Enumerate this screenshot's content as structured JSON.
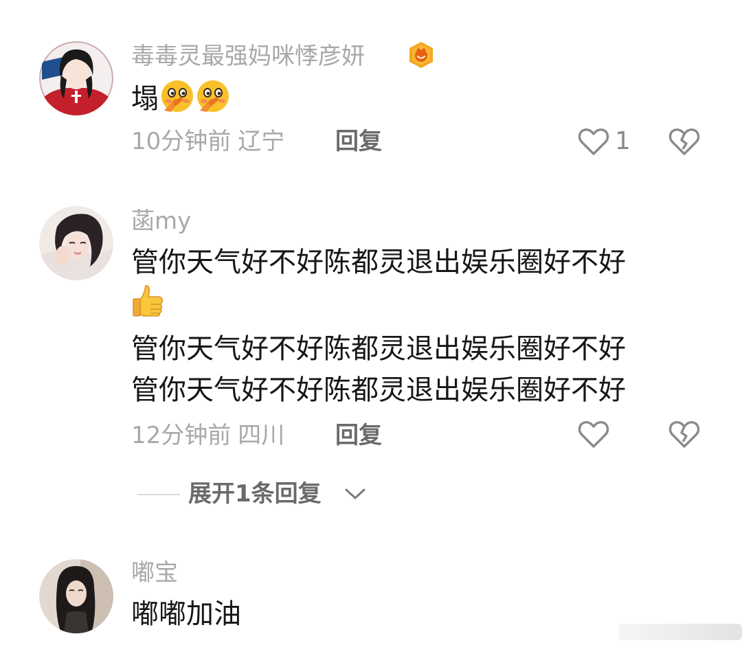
{
  "comments": [
    {
      "username": "毒毒灵最强妈咪悸彦妍",
      "has_badge": true,
      "text_lines": [
        "塌"
      ],
      "emoji": [
        "flushed-hand-over-mouth",
        "flushed-hand-over-mouth"
      ],
      "time": "10分钟前",
      "location": "辽宁",
      "reply_label": "回复",
      "like_count": "1"
    },
    {
      "username": "菡my",
      "text_lines": [
        "管你天气好不好陈都灵退出娱乐圈好不好",
        "管你天气好不好陈都灵退出娱乐圈好不好",
        "管你天气好不好陈都灵退出娱乐圈好不好"
      ],
      "emoji": [
        "thumbs-up"
      ],
      "time": "12分钟前",
      "location": "四川",
      "reply_label": "回复",
      "expand_label": "展开1条回复"
    },
    {
      "username": "嘟宝",
      "text_lines": [
        "嘟嘟加油"
      ]
    }
  ],
  "colors": {
    "username": "#a8a8a8",
    "content": "#161616",
    "meta": "#a8a8a8",
    "reply": "#6a6a6a",
    "icon": "#8a8a8a",
    "badge": "#f5a623"
  }
}
